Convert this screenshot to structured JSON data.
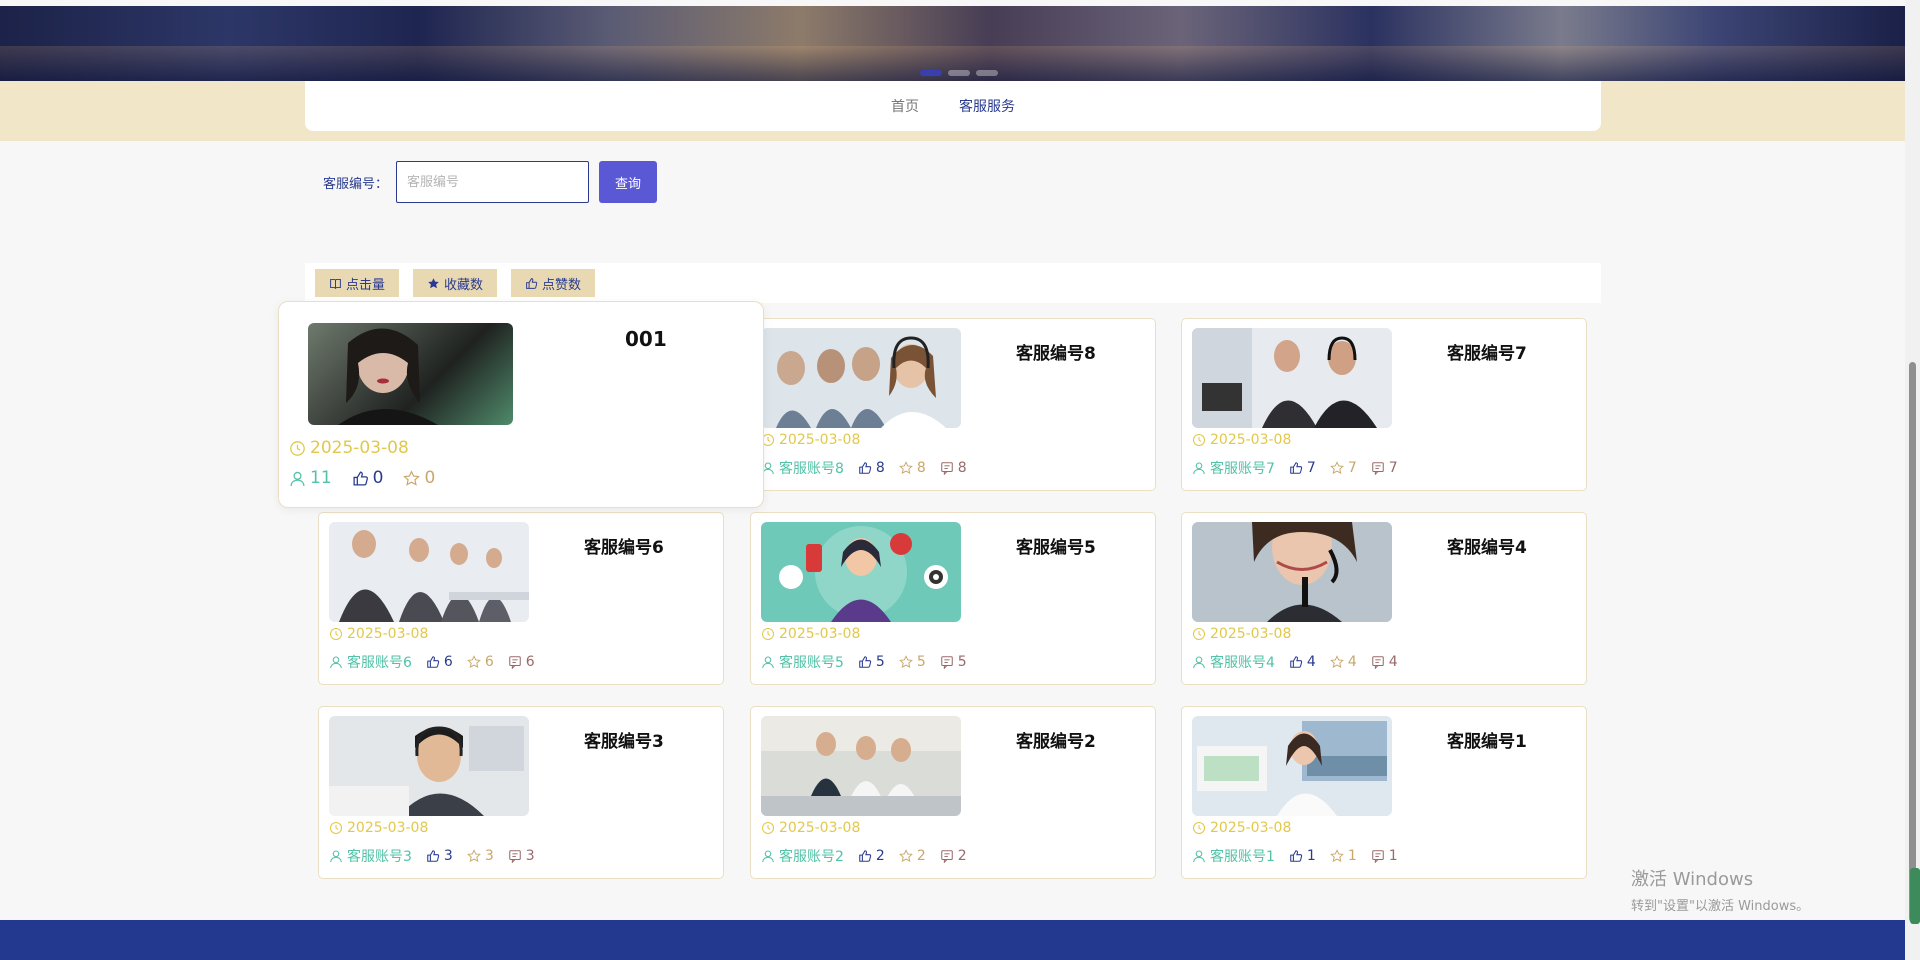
{
  "nav": {
    "items": [
      "首页",
      "客服服务"
    ],
    "active_index": 1
  },
  "search": {
    "label": "客服编号：",
    "placeholder": "客服编号",
    "value": "",
    "button": "查询"
  },
  "sort": {
    "items": [
      {
        "label": "点击量",
        "icon": "book-icon"
      },
      {
        "label": "收藏数",
        "icon": "star-filled-icon"
      },
      {
        "label": "点赞数",
        "icon": "thumbs-up-icon"
      }
    ]
  },
  "cards": [
    {
      "title": "001",
      "date": "2025-03-08",
      "user": "11",
      "likes": "0",
      "stars": "0",
      "comments": null,
      "img": "portrait-woman"
    },
    {
      "title": "客服编号8",
      "date": "2025-03-08",
      "user": "客服账号8",
      "likes": "8",
      "stars": "8",
      "comments": "8",
      "img": "team-headset-woman"
    },
    {
      "title": "客服编号7",
      "date": "2025-03-08",
      "user": "客服账号7",
      "likes": "7",
      "stars": "7",
      "comments": "7",
      "img": "office-men"
    },
    {
      "title": "客服编号6",
      "date": "2025-03-08",
      "user": "客服账号6",
      "likes": "6",
      "stars": "6",
      "comments": "6",
      "img": "call-center-row"
    },
    {
      "title": "客服编号5",
      "date": "2025-03-08",
      "user": "客服账号5",
      "likes": "5",
      "stars": "5",
      "comments": "5",
      "img": "illustration-agent"
    },
    {
      "title": "客服编号4",
      "date": "2025-03-08",
      "user": "客服账号4",
      "likes": "4",
      "stars": "4",
      "comments": "4",
      "img": "smiling-headset"
    },
    {
      "title": "客服编号3",
      "date": "2025-03-08",
      "user": "客服账号3",
      "likes": "3",
      "stars": "3",
      "comments": "3",
      "img": "man-headset"
    },
    {
      "title": "客服编号2",
      "date": "2025-03-08",
      "user": "客服账号2",
      "likes": "2",
      "stars": "2",
      "comments": "2",
      "img": "office-team"
    },
    {
      "title": "客服编号1",
      "date": "2025-03-08",
      "user": "客服账号1",
      "likes": "1",
      "stars": "1",
      "comments": "1",
      "img": "woman-office-window"
    }
  ],
  "watermark": {
    "line1": "激活 Windows",
    "line2": "转到\"设置\"以激活 Windows。"
  },
  "colors": {
    "primary": "#2a3b8f",
    "button": "#5b58d6",
    "sort_bg": "#e8d9b3",
    "date": "#e2c84a",
    "user": "#52c2a8",
    "nav_band": "#f2e6c8",
    "footer": "#22398f"
  }
}
